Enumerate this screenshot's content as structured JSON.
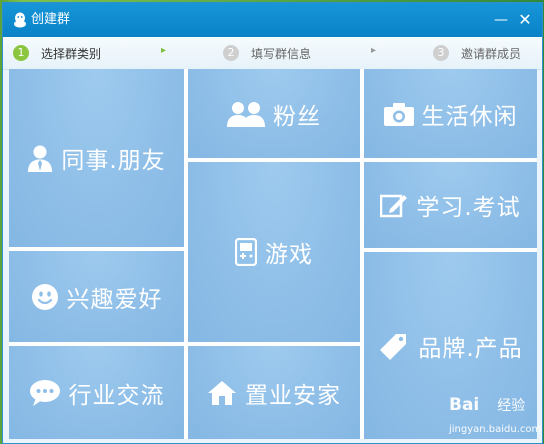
{
  "window": {
    "title": "创建群",
    "minimize_glyph": "—",
    "close_glyph": "✕"
  },
  "steps": [
    {
      "num": "1",
      "label": "选择群类别",
      "state": "active"
    },
    {
      "num": "2",
      "label": "填写群信息",
      "state": "inactive"
    },
    {
      "num": "3",
      "label": "邀请群成员",
      "state": "inactive"
    }
  ],
  "step_arrows": [
    "▸",
    "▸"
  ],
  "categories": {
    "colleague_friend": {
      "label": "同事.朋友",
      "icon": "person-icon"
    },
    "fans": {
      "label": "粉丝",
      "icon": "people-icon"
    },
    "life_leisure": {
      "label": "生活休闲",
      "icon": "camera-icon"
    },
    "study_exam": {
      "label": "学习.考试",
      "icon": "edit-icon"
    },
    "games": {
      "label": "游戏",
      "icon": "gamepad-icon"
    },
    "hobbies": {
      "label": "兴趣爱好",
      "icon": "smiley-icon"
    },
    "brand_product": {
      "label": "品牌.产品",
      "icon": "tag-icon"
    },
    "industry": {
      "label": "行业交流",
      "icon": "chat-icon"
    },
    "real_estate": {
      "label": "置业安家",
      "icon": "home-icon"
    }
  },
  "watermark": {
    "logo": "Bai",
    "logo_suffix": "经验",
    "url": "jingyan.baidu.com"
  },
  "colors": {
    "titlebar": "#0a82c7",
    "tile": "#8fbfe8",
    "step_active": "#8cc63f",
    "step_inactive": "#cfcfcf"
  }
}
